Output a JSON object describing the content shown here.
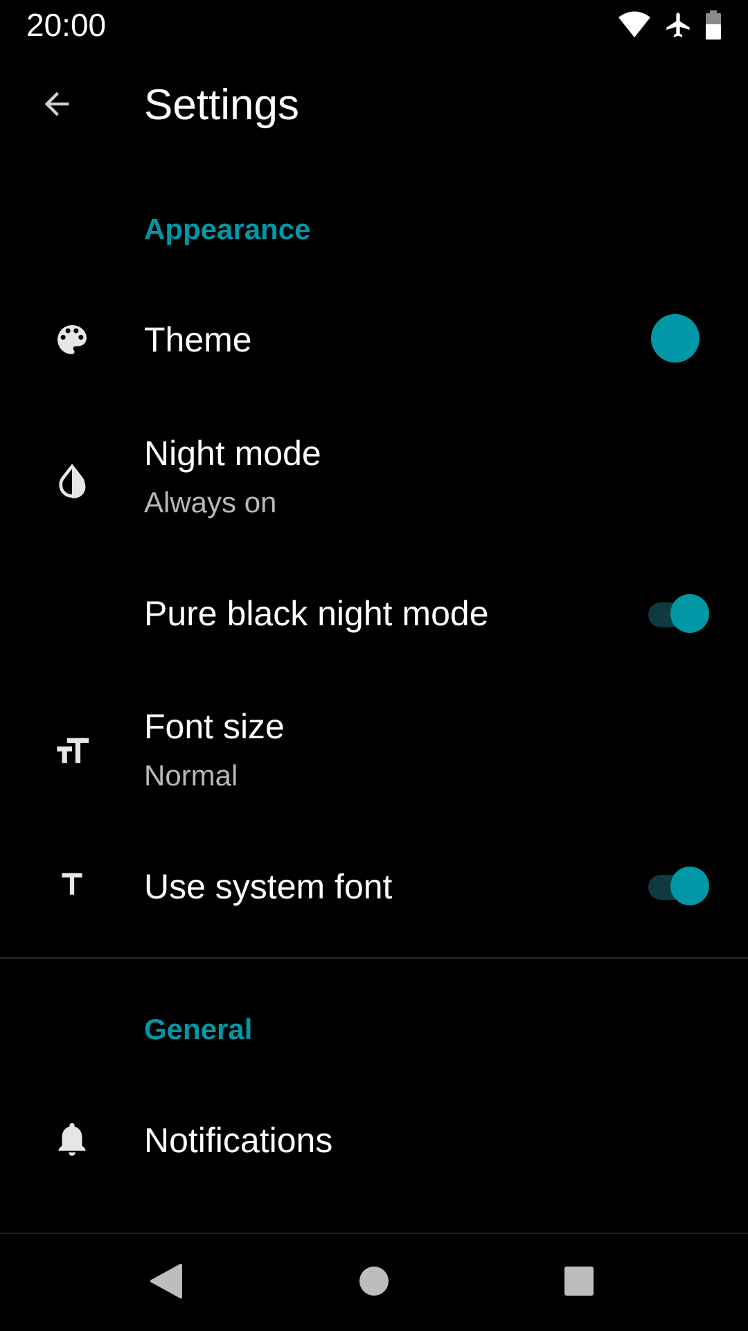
{
  "status_bar": {
    "time": "20:00",
    "icons": [
      "wifi-icon",
      "airplane-mode-icon",
      "battery-icon"
    ]
  },
  "app_bar": {
    "title": "Settings",
    "back_icon": "arrow-back-icon"
  },
  "sections": [
    {
      "header": "Appearance",
      "items": [
        {
          "title": "Theme",
          "summary": "",
          "icon": "palette-icon",
          "widget": "color",
          "color": "#0097a7"
        },
        {
          "title": "Night mode",
          "summary": "Always on",
          "icon": "invert-colors-icon",
          "widget": "none"
        },
        {
          "title": "Pure black night mode",
          "summary": "",
          "icon": "",
          "widget": "switch",
          "checked": true
        },
        {
          "title": "Font size",
          "summary": "Normal",
          "icon": "text-size-icon",
          "widget": "none"
        },
        {
          "title": "Use system font",
          "summary": "",
          "icon": "text-icon",
          "widget": "switch",
          "checked": true
        }
      ]
    },
    {
      "header": "General",
      "items": [
        {
          "title": "Notifications",
          "summary": "",
          "icon": "bell-icon",
          "widget": "none"
        }
      ]
    }
  ],
  "colors": {
    "accent": "#0097a7",
    "switch_track_on": "#0d3b40",
    "background": "#000000",
    "divider": "#2a2a2a",
    "summary_text": "#b8b8b8"
  },
  "nav_bar": {
    "buttons": [
      "nav-back-icon",
      "nav-home-icon",
      "nav-recents-icon"
    ]
  }
}
